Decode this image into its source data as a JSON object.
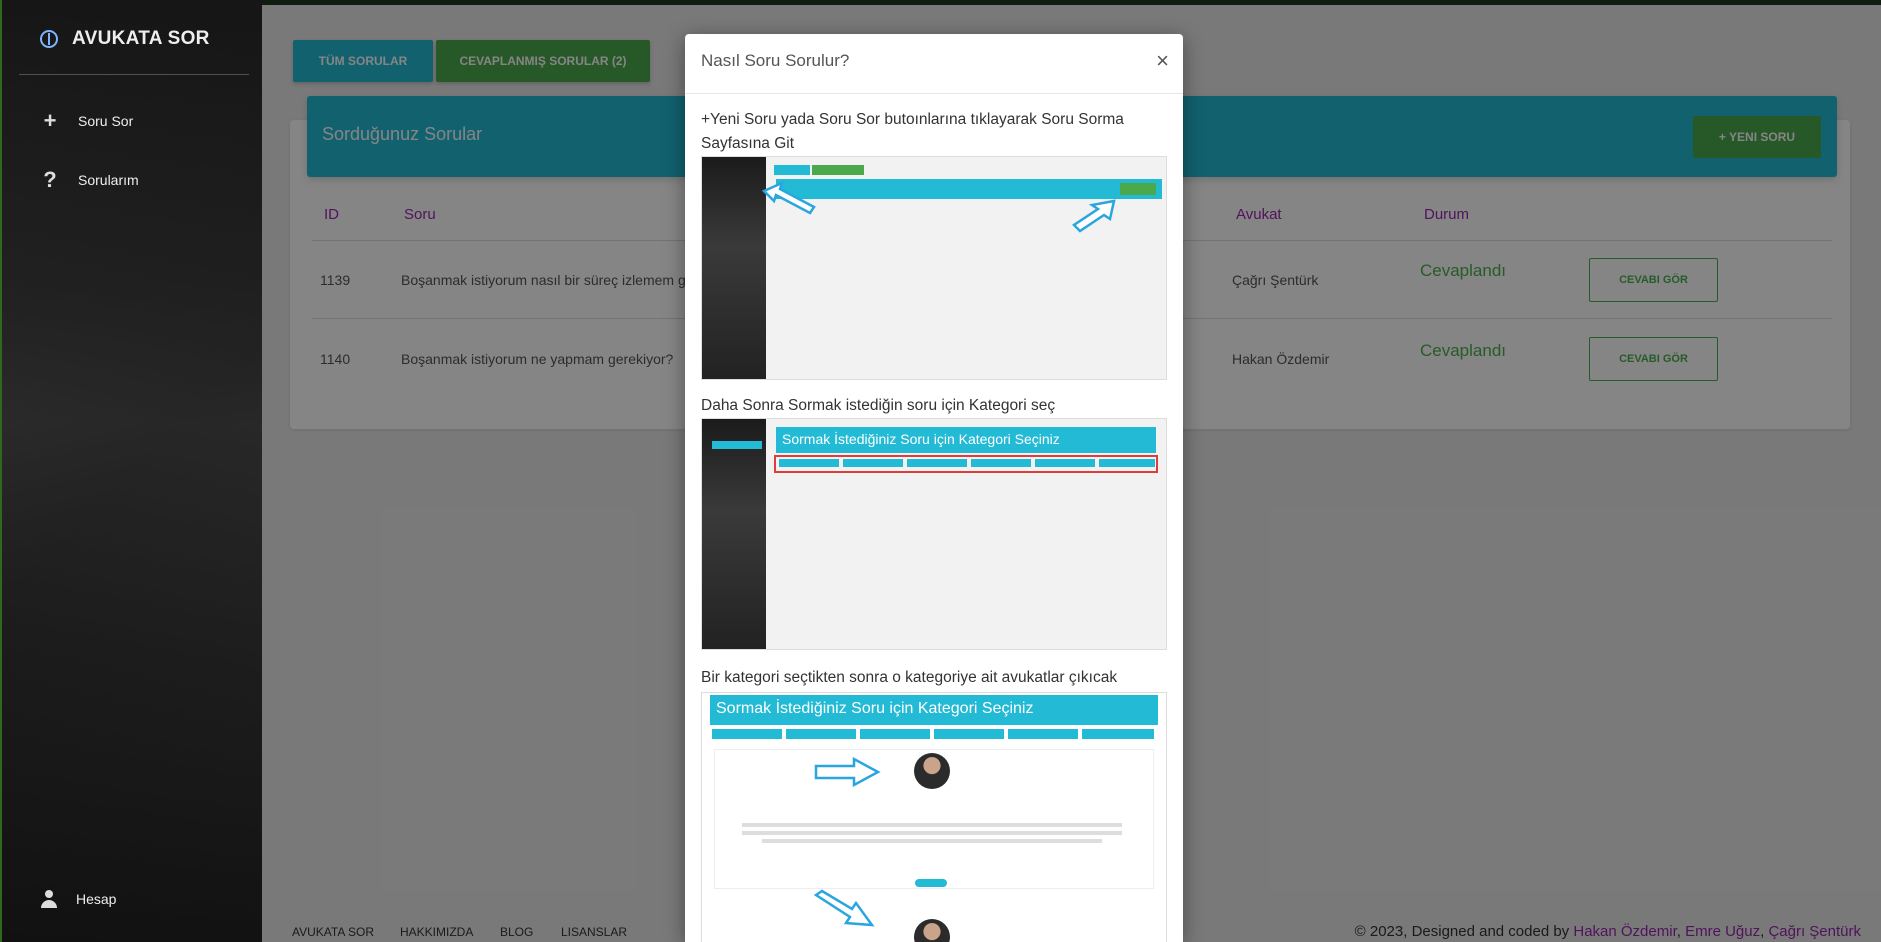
{
  "sidebar": {
    "brand": "AVUKATA SOR",
    "items": [
      {
        "label": "Soru Sor",
        "icon": "plus-icon"
      },
      {
        "label": "Sorularım",
        "icon": "question-icon"
      }
    ],
    "account_label": "Hesap"
  },
  "tabs": {
    "all": "TÜM SORULAR",
    "answered": "CEVAPLANMIŞ SORULAR (2)"
  },
  "card": {
    "title": "Sorduğunuz Sorular",
    "new_button": "+ YENI SORU",
    "columns": [
      "ID",
      "Soru",
      "Avukat",
      "Durum"
    ],
    "rows": [
      {
        "id": "1139",
        "question": "Boşanmak istiyorum nasıl bir süreç izlemem ge",
        "lawyer": "Çağrı Şentürk",
        "status": "Cevaplandı",
        "action": "CEVABI GÖR"
      },
      {
        "id": "1140",
        "question": "Boşanmak istiyorum ne yapmam gerekiyor?",
        "lawyer": "Hakan Özdemir",
        "status": "Cevaplandı",
        "action": "CEVABI GÖR"
      }
    ]
  },
  "footer": {
    "links": [
      "AVUKATA SOR",
      "HAKKIMIZDA",
      "BLOG",
      "LISANSLAR"
    ],
    "copyright_prefix": "© 2023, Designed and coded by",
    "author1": "Hakan Özdemir",
    "sep1": ",",
    "author2": "Emre Uğuz",
    "sep2": ",",
    "author3": "Çağrı Şentürk"
  },
  "modal": {
    "title": "Nasıl Soru Sorulur?",
    "close": "×",
    "step1": "+Yeni Soru yada Soru Sor butoınlarına tıklayarak Soru Sorma Sayfasına Git",
    "step2": "Daha Sonra Sormak istediğin soru için Kategori seç",
    "step3": "Bir kategori seçtikten sonra o kategoriye ait avukatlar çıkıcak",
    "shot_category_title": "Sormak İstediğiniz Soru için Kategori Seçiniz"
  },
  "colors": {
    "accent": "#22bad4",
    "green": "#4ba94b",
    "purple": "#9c27b0"
  }
}
